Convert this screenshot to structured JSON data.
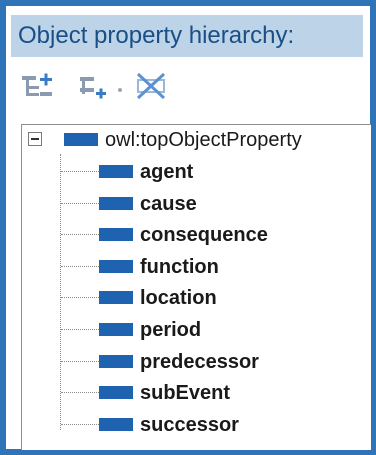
{
  "panel": {
    "title": "Object property hierarchy:"
  },
  "toolbar": {
    "buttons": [
      {
        "name": "add-sub-property-icon"
      },
      {
        "name": "add-sibling-property-icon"
      },
      {
        "name": "delete-property-icon"
      }
    ]
  },
  "tree": {
    "root": {
      "label": "owl:topObjectProperty",
      "expanded": true
    },
    "children": [
      {
        "label": "agent"
      },
      {
        "label": "cause"
      },
      {
        "label": "consequence"
      },
      {
        "label": "function"
      },
      {
        "label": "location"
      },
      {
        "label": "period"
      },
      {
        "label": "predecessor"
      },
      {
        "label": "subEvent"
      },
      {
        "label": "successor"
      }
    ]
  },
  "colors": {
    "frame": "#2f73b8",
    "header_bg": "#bcd3e8",
    "header_text": "#1a4f86",
    "property_icon": "#1f62b0"
  }
}
